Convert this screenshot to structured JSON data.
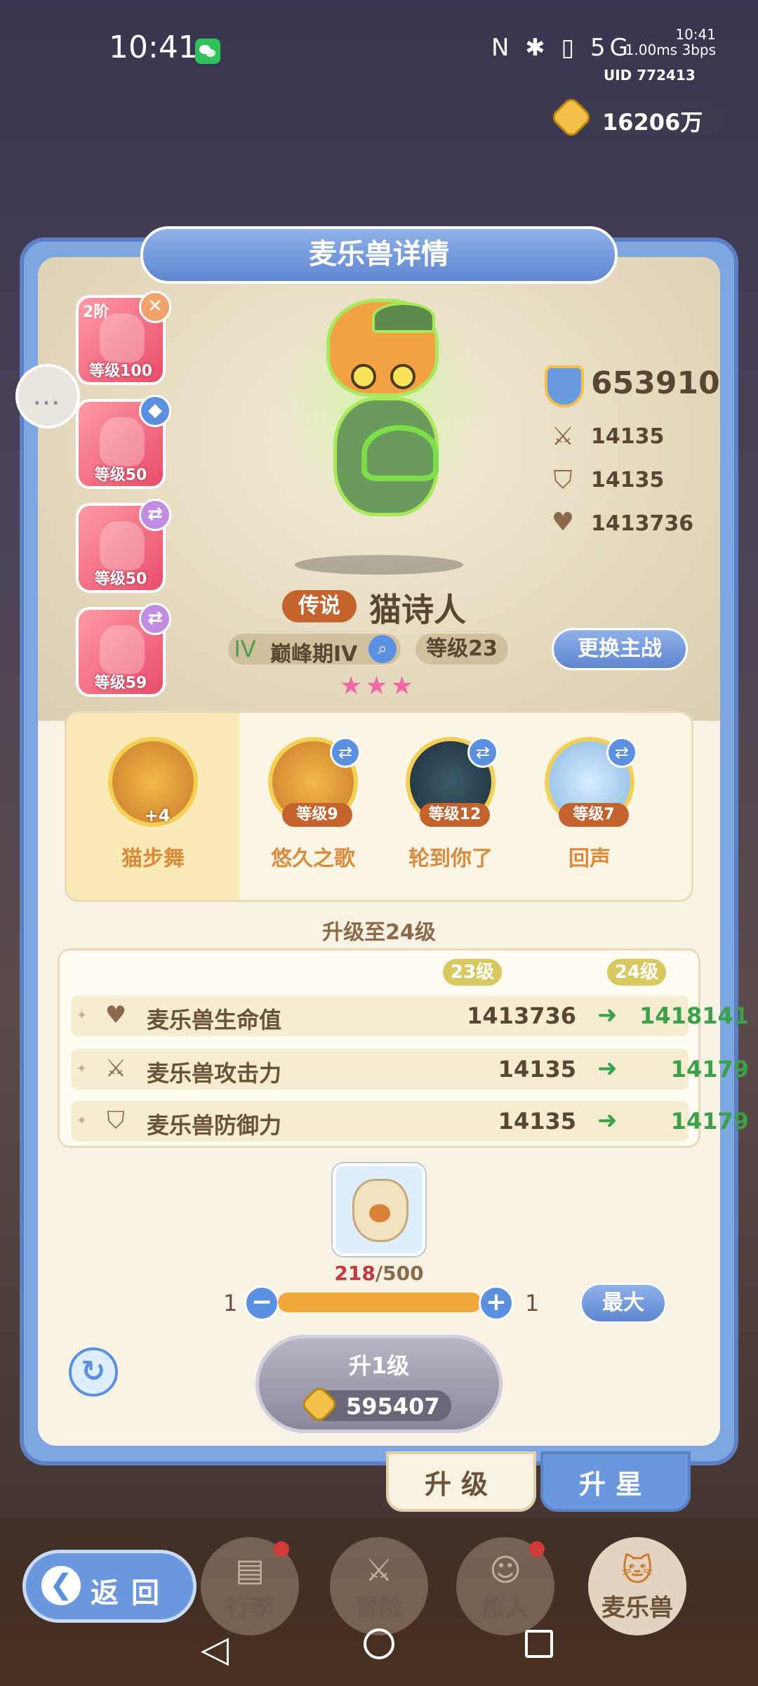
{
  "status_bar": {
    "time": "10:41",
    "icons": "N ✱ ▯ 5G",
    "net_time": "10:41",
    "net_speed": "1.00ms 3bps",
    "uid": "UID 772413"
  },
  "currency": {
    "amount": "16206万"
  },
  "panel": {
    "title": "麦乐兽详情"
  },
  "slots": [
    {
      "tier": "2阶",
      "level": "等级100",
      "badge": "✕"
    },
    {
      "tier": "",
      "level": "等级50",
      "badge": "◆"
    },
    {
      "tier": "",
      "level": "等级50",
      "badge": "⇄"
    },
    {
      "tier": "",
      "level": "等级59",
      "badge": "⇄"
    }
  ],
  "power": {
    "total": "653910",
    "attack": "14135",
    "defense": "14135",
    "hp": "1413736"
  },
  "pet": {
    "rarity": "传说",
    "name": "猫诗人",
    "stage": "巅峰期IV",
    "stage_icon": "IV",
    "level": "等级23",
    "swap_label": "更换主战",
    "stars": "★★★"
  },
  "skills": [
    {
      "name": "猫步舞",
      "badge": "+4"
    },
    {
      "name": "悠久之歌",
      "level": "等级9"
    },
    {
      "name": "轮到你了",
      "level": "等级12"
    },
    {
      "name": "回声",
      "level": "等级7"
    }
  ],
  "upgrade": {
    "title": "升级至24级",
    "col_current": "23级",
    "col_next": "24级",
    "rows": [
      {
        "label": "麦乐兽生命值",
        "current": "1413736",
        "next": "1418141"
      },
      {
        "label": "麦乐兽攻击力",
        "current": "14135",
        "next": "14179"
      },
      {
        "label": "麦乐兽防御力",
        "current": "14135",
        "next": "14179"
      }
    ]
  },
  "item": {
    "owned": "218",
    "required": "/500"
  },
  "quantity": {
    "min": "1",
    "max": "1",
    "minus": "−",
    "plus": "+",
    "max_button": "最大",
    "fill_fraction": 1.0
  },
  "levelup": {
    "label": "升1级",
    "cost": "595407"
  },
  "tabs": {
    "upgrade": "升级",
    "starup": "升星"
  },
  "back": {
    "label": "返回",
    "arrow": "❮"
  },
  "nav": [
    {
      "label": "行李",
      "icon": "▤"
    },
    {
      "label": "冒险",
      "icon": "⚔"
    },
    {
      "label": "旅人",
      "icon": "☺"
    },
    {
      "label": "麦乐兽",
      "icon": "🐱"
    }
  ],
  "colors": {
    "accent_blue": "#5b8fe0",
    "panel_bg": "#f8f2e4",
    "increase_green": "#3aa04a",
    "rarity_orange": "#c4632e"
  }
}
